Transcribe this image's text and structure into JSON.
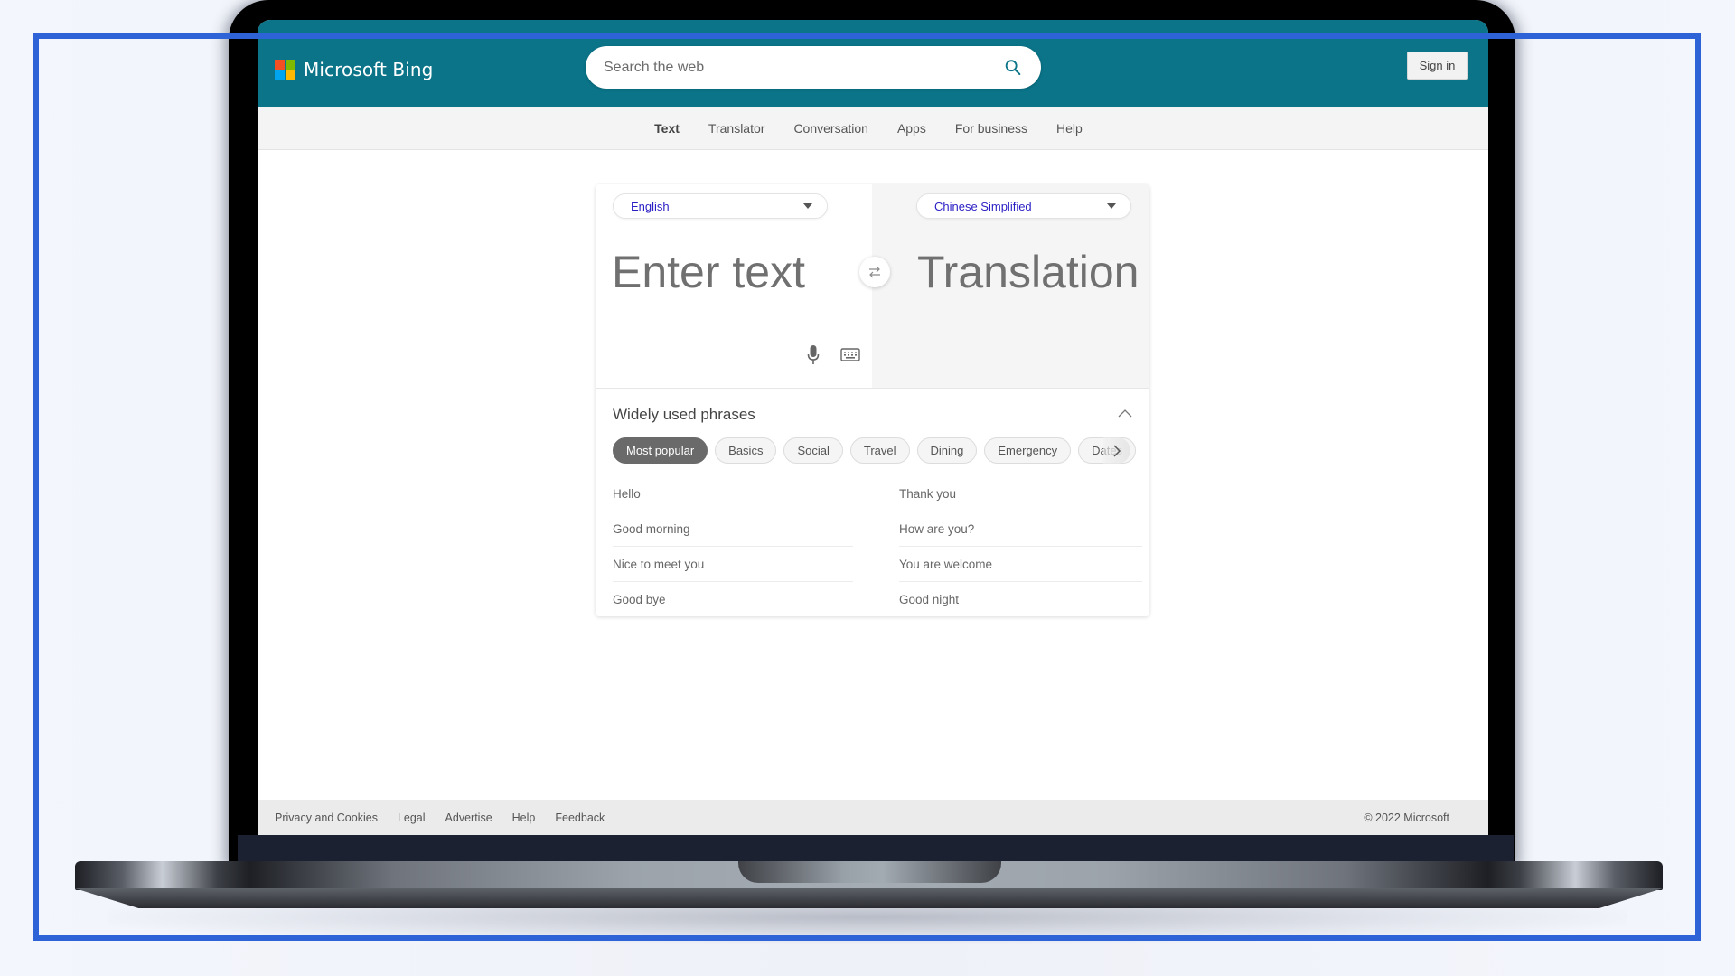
{
  "header": {
    "brand": "Microsoft Bing",
    "logo_colors": [
      "#f25022",
      "#7fba00",
      "#00a4ef",
      "#ffb900"
    ],
    "search_placeholder": "Search the web",
    "search_value": "",
    "sign_in_label": "Sign in",
    "accent_color": "#0b7489"
  },
  "nav": {
    "items": [
      {
        "label": "Text",
        "active": true
      },
      {
        "label": "Translator",
        "active": false
      },
      {
        "label": "Conversation",
        "active": false
      },
      {
        "label": "Apps",
        "active": false
      },
      {
        "label": "For business",
        "active": false
      },
      {
        "label": "Help",
        "active": false
      }
    ]
  },
  "translator": {
    "source_language": "English",
    "target_language": "Chinese Simplified",
    "input_placeholder": "Enter text",
    "input_value": "",
    "translation_placeholder": "Translation",
    "icons": {
      "swap": "swap-arrows-icon",
      "mic": "microphone-icon",
      "keyboard": "keyboard-icon"
    }
  },
  "phrases": {
    "title": "Widely used phrases",
    "collapse_icon": "chevron-up-icon",
    "categories": [
      {
        "label": "Most popular",
        "active": true
      },
      {
        "label": "Basics",
        "active": false
      },
      {
        "label": "Social",
        "active": false
      },
      {
        "label": "Travel",
        "active": false
      },
      {
        "label": "Dining",
        "active": false
      },
      {
        "label": "Emergency",
        "active": false
      },
      {
        "label": "Dates",
        "active": false
      }
    ],
    "left": [
      "Hello",
      "Good morning",
      "Nice to meet you",
      "Good bye"
    ],
    "right": [
      "Thank you",
      "How are you?",
      "You are welcome",
      "Good night"
    ]
  },
  "footer": {
    "links": [
      "Privacy and Cookies",
      "Legal",
      "Advertise",
      "Help",
      "Feedback"
    ],
    "copyright": "© 2022 Microsoft"
  }
}
